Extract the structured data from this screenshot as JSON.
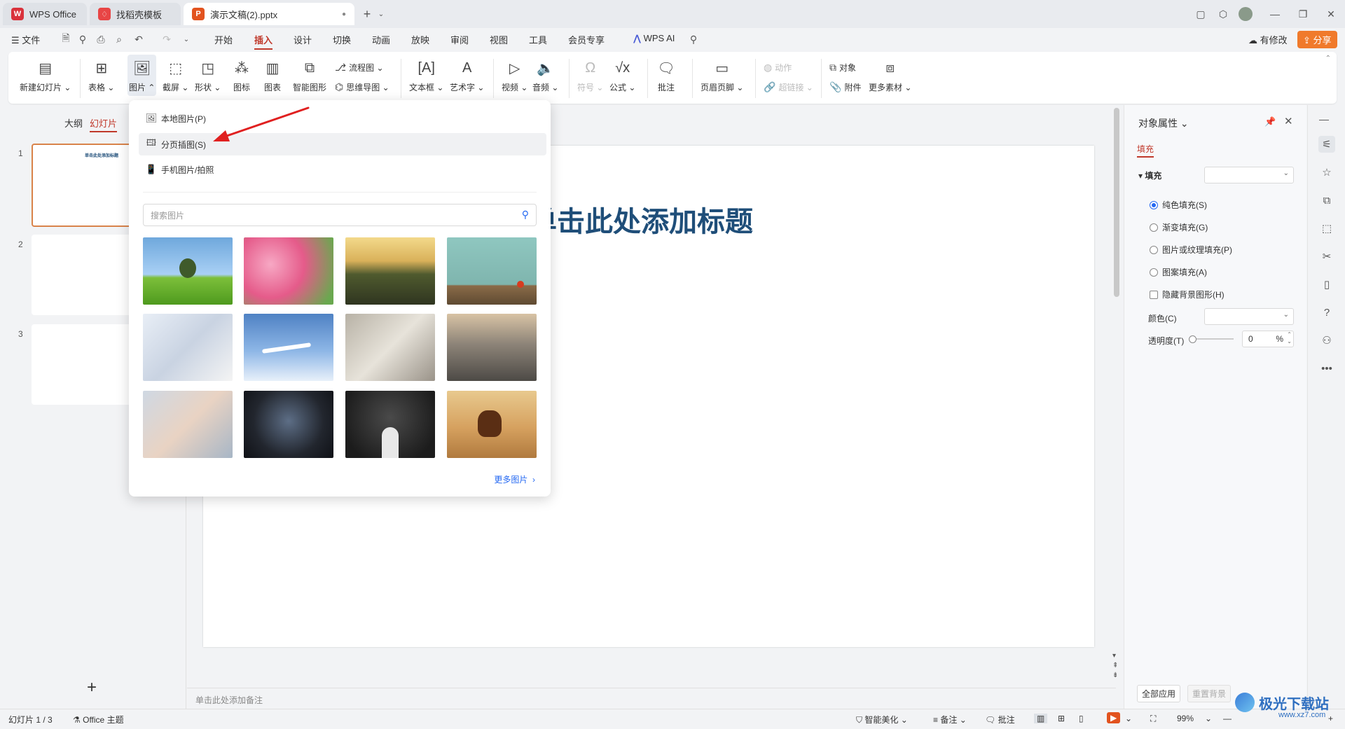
{
  "tabs": [
    {
      "label": "WPS Office"
    },
    {
      "label": "找稻壳模板"
    },
    {
      "label": "演示文稿(2).pptx"
    }
  ],
  "menu": {
    "file": "文件",
    "items": [
      "开始",
      "插入",
      "设计",
      "切换",
      "动画",
      "放映",
      "审阅",
      "视图",
      "工具",
      "会员专享"
    ],
    "active": "插入",
    "wps_ai": "WPS AI",
    "has_changes": "有修改",
    "share": "分享"
  },
  "ribbon": {
    "new_slide": "新建幻灯片",
    "table": "表格",
    "picture": "图片",
    "screenshot": "截屏",
    "shape": "形状",
    "icon": "图标",
    "chart": "图表",
    "smart_graphic": "智能图形",
    "flowchart": "流程图",
    "mindmap": "思维导图",
    "textbox": "文本框",
    "wordart": "艺术字",
    "video": "视频",
    "audio": "音频",
    "symbol": "符号",
    "formula": "公式",
    "comment": "批注",
    "header_footer": "页眉页脚",
    "action": "动作",
    "hyperlink": "超链接",
    "object": "对象",
    "attachment": "附件",
    "more_materials": "更多素材"
  },
  "left_panel": {
    "tab_outline": "大纲",
    "tab_slides": "幻灯片",
    "slide_numbers": [
      "1",
      "2",
      "3"
    ],
    "thumb1_title": "单击此处添加标题"
  },
  "slide": {
    "title": "单击此处添加标题"
  },
  "notes_placeholder": "单击此处添加备注",
  "dropdown": {
    "local_picture": "本地图片(P)",
    "page_insert": "分页插图(S)",
    "phone_picture": "手机图片/拍照",
    "search_placeholder": "搜索图片",
    "more_pictures": "更多图片",
    "images": [
      "tree",
      "tulips",
      "wind-farm",
      "apple-desk",
      "hand-writing",
      "airplane",
      "handshake-documents",
      "treadmills",
      "hands-raised",
      "excited-man-laptop",
      "question-marks-boy",
      "running-horse"
    ]
  },
  "right_panel": {
    "title": "对象属性",
    "tab_fill": "填充",
    "section_fill": "填充",
    "solid": "纯色填充(S)",
    "gradient": "渐变填充(G)",
    "picture_texture": "图片或纹理填充(P)",
    "pattern": "图案填充(A)",
    "hide_bg": "隐藏背景图形(H)",
    "color_label": "颜色(C)",
    "transparency_label": "透明度(T)",
    "transparency_value": "0",
    "percent": "%",
    "apply_all": "全部应用",
    "reset_bg": "重置背景"
  },
  "status": {
    "slide_count": "幻灯片 1 / 3",
    "theme": "Office 主题",
    "smart_beautify": "智能美化",
    "notes": "备注",
    "comments": "批注",
    "zoom": "99%"
  },
  "watermark": {
    "text": "极光下载站",
    "url": "www.xz7.com"
  },
  "colors": {
    "accent": "#d9534f",
    "active_menu": "#c0392b",
    "title": "#1f4e79",
    "share_bg": "#f07a2b"
  }
}
